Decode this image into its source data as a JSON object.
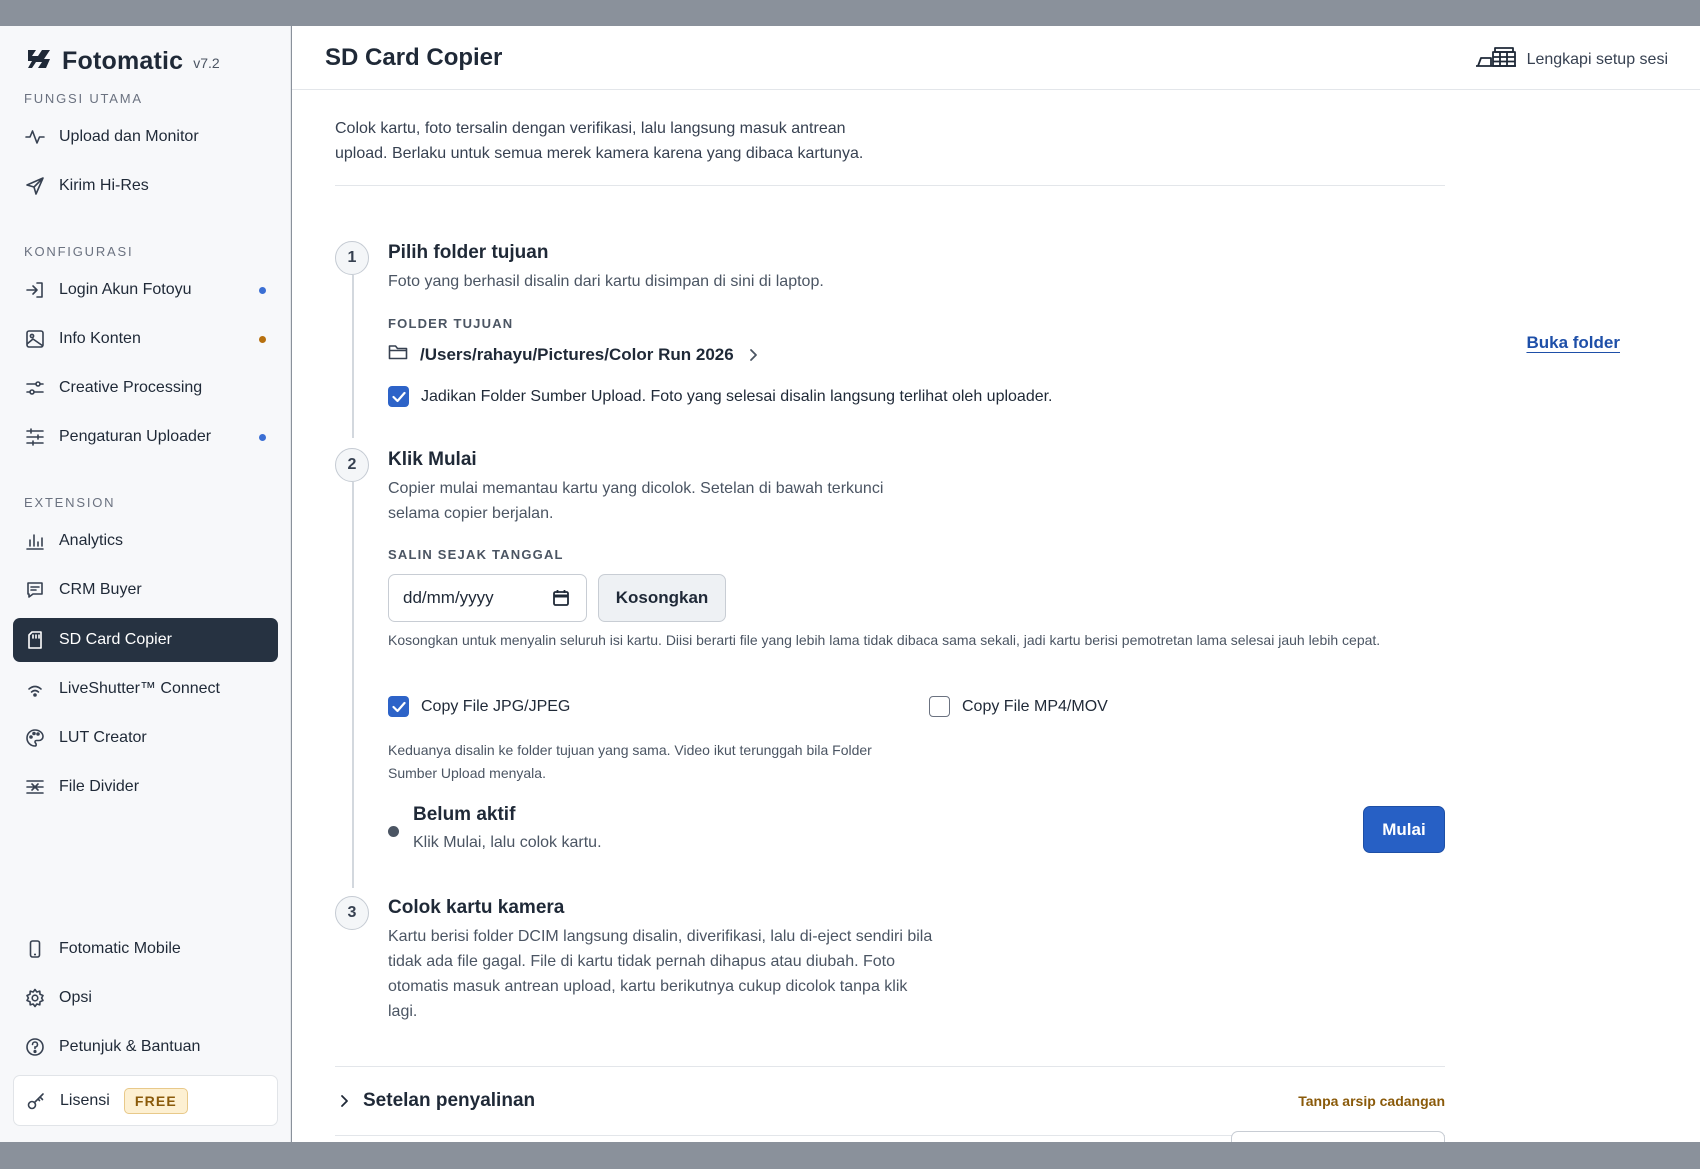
{
  "app": {
    "name": "Fotomatic",
    "version": "v7.2"
  },
  "sidebar": {
    "sections": {
      "main": "FUNGSI UTAMA",
      "config": "KONFIGURASI",
      "extension": "EXTENSION"
    },
    "items": [
      {
        "label": "Upload dan Monitor",
        "icon": "activity-icon"
      },
      {
        "label": "Kirim Hi-Res",
        "icon": "send-icon"
      },
      {
        "label": "Login Akun Fotoyu",
        "icon": "login-icon",
        "dot": "#3b6fd4"
      },
      {
        "label": "Info Konten",
        "icon": "image-icon",
        "dot": "#b7700f"
      },
      {
        "label": "Creative Processing",
        "icon": "sliders-icon"
      },
      {
        "label": "Pengaturan Uploader",
        "icon": "settings-sliders-icon",
        "dot": "#3b6fd4"
      },
      {
        "label": "Analytics",
        "icon": "bar-chart-icon"
      },
      {
        "label": "CRM Buyer",
        "icon": "message-icon"
      },
      {
        "label": "SD Card Copier",
        "icon": "sd-card-icon",
        "active": true
      },
      {
        "label": "LiveShutter™ Connect",
        "icon": "wifi-icon"
      },
      {
        "label": "LUT Creator",
        "icon": "palette-icon"
      },
      {
        "label": "File Divider",
        "icon": "divider-icon"
      },
      {
        "label": "Fotomatic Mobile",
        "icon": "phone-icon"
      },
      {
        "label": "Opsi",
        "icon": "gear-icon"
      },
      {
        "label": "Petunjuk & Bantuan",
        "icon": "help-icon"
      }
    ],
    "license": {
      "label": "Lisensi",
      "badge": "FREE",
      "icon": "key-icon"
    }
  },
  "header": {
    "title": "SD Card Copier",
    "setup_link": "Lengkapi setup sesi"
  },
  "intro": "Colok kartu, foto tersalin dengan verifikasi, lalu langsung masuk antrean upload. Berlaku untuk semua merek kamera karena yang dibaca kartunya.",
  "steps": {
    "one": {
      "num": "1",
      "title": "Pilih folder tujuan",
      "desc": "Foto yang berhasil disalin dari kartu disimpan di sini di laptop.",
      "field_label": "FOLDER TUJUAN",
      "folder_path": "/Users/rahayu/Pictures/Color Run 2026",
      "open_folder": "Buka folder",
      "source_checkbox": {
        "label": "Jadikan Folder Sumber Upload. Foto yang selesai disalin langsung terlihat oleh uploader.",
        "checked": true
      }
    },
    "two": {
      "num": "2",
      "title": "Klik Mulai",
      "desc": "Copier mulai memantau kartu yang dicolok. Setelan di bawah terkunci selama copier berjalan.",
      "field_label": "SALIN SEJAK TANGGAL",
      "date_placeholder": "dd/mm/yyyy",
      "clear_button": "Kosongkan",
      "date_hint": "Kosongkan untuk menyalin seluruh isi kartu. Diisi berarti file yang lebih lama tidak dibaca sama sekali, jadi kartu berisi pemotretan lama selesai jauh lebih cepat.",
      "copy_jpg": {
        "label": "Copy File JPG/JPEG",
        "checked": true
      },
      "copy_mp4": {
        "label": "Copy File MP4/MOV",
        "checked": false
      },
      "copy_hint": "Keduanya disalin ke folder tujuan yang sama. Video ikut terunggah bila Folder Sumber Upload menyala.",
      "status_title": "Belum aktif",
      "status_sub": "Klik Mulai, lalu colok kartu.",
      "start_button": "Mulai"
    },
    "three": {
      "num": "3",
      "title": "Colok kartu kamera",
      "desc": "Kartu berisi folder DCIM langsung disalin, diverifikasi, lalu di-eject sendiri bila tidak ada file gagal. File di kartu tidak pernah dihapus atau diubah. Foto otomatis masuk antrean upload, kartu berikutnya cukup dicolok tanpa klik lagi."
    }
  },
  "accordion": {
    "title": "Setelan penyalinan",
    "meta": "Tanpa arsip cadangan"
  },
  "colors": {
    "accent": "#2760c5",
    "active_nav": "#263241",
    "link": "#1e4fa8",
    "warning_text": "#8a5a0a"
  }
}
